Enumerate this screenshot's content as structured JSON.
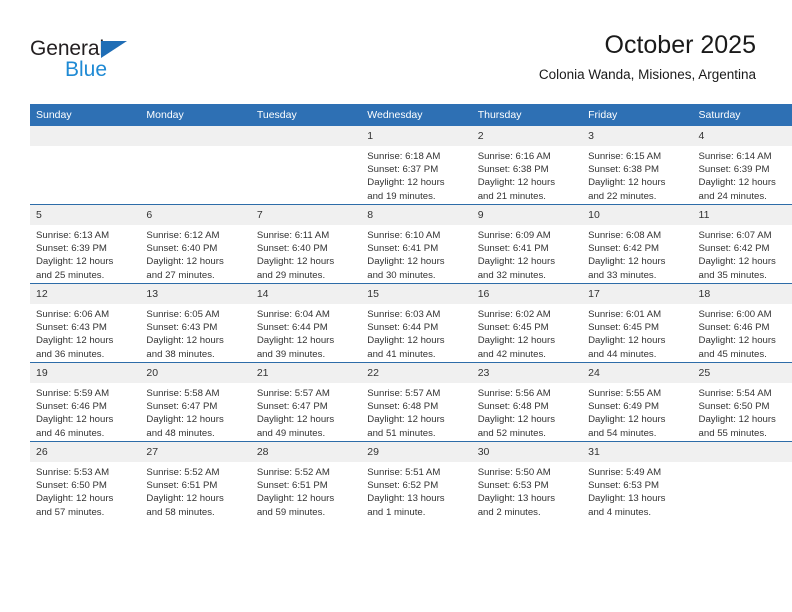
{
  "logo": {
    "word_top": "General",
    "word_bottom": "Blue",
    "triangle_color": "#1f6db5",
    "bottom_color": "#1f8ad4"
  },
  "header": {
    "title": "October 2025",
    "subtitle": "Colonia Wanda, Misiones, Argentina"
  },
  "theme": {
    "header_blue": "#2e70b4",
    "row_rule": "#2d6ca8",
    "daynum_band": "#f0f0f0",
    "text": "#333333"
  },
  "calendar": {
    "weekday_headers": [
      "Sunday",
      "Monday",
      "Tuesday",
      "Wednesday",
      "Thursday",
      "Friday",
      "Saturday"
    ],
    "weeks": [
      [
        {
          "day": "",
          "sunrise": "",
          "sunset": "",
          "daylight_1": "",
          "daylight_2": "",
          "empty": true
        },
        {
          "day": "",
          "sunrise": "",
          "sunset": "",
          "daylight_1": "",
          "daylight_2": "",
          "empty": true
        },
        {
          "day": "",
          "sunrise": "",
          "sunset": "",
          "daylight_1": "",
          "daylight_2": "",
          "empty": true
        },
        {
          "day": "1",
          "sunrise": "Sunrise: 6:18 AM",
          "sunset": "Sunset: 6:37 PM",
          "daylight_1": "Daylight: 12 hours",
          "daylight_2": "and 19 minutes."
        },
        {
          "day": "2",
          "sunrise": "Sunrise: 6:16 AM",
          "sunset": "Sunset: 6:38 PM",
          "daylight_1": "Daylight: 12 hours",
          "daylight_2": "and 21 minutes."
        },
        {
          "day": "3",
          "sunrise": "Sunrise: 6:15 AM",
          "sunset": "Sunset: 6:38 PM",
          "daylight_1": "Daylight: 12 hours",
          "daylight_2": "and 22 minutes."
        },
        {
          "day": "4",
          "sunrise": "Sunrise: 6:14 AM",
          "sunset": "Sunset: 6:39 PM",
          "daylight_1": "Daylight: 12 hours",
          "daylight_2": "and 24 minutes."
        }
      ],
      [
        {
          "day": "5",
          "sunrise": "Sunrise: 6:13 AM",
          "sunset": "Sunset: 6:39 PM",
          "daylight_1": "Daylight: 12 hours",
          "daylight_2": "and 25 minutes."
        },
        {
          "day": "6",
          "sunrise": "Sunrise: 6:12 AM",
          "sunset": "Sunset: 6:40 PM",
          "daylight_1": "Daylight: 12 hours",
          "daylight_2": "and 27 minutes."
        },
        {
          "day": "7",
          "sunrise": "Sunrise: 6:11 AM",
          "sunset": "Sunset: 6:40 PM",
          "daylight_1": "Daylight: 12 hours",
          "daylight_2": "and 29 minutes."
        },
        {
          "day": "8",
          "sunrise": "Sunrise: 6:10 AM",
          "sunset": "Sunset: 6:41 PM",
          "daylight_1": "Daylight: 12 hours",
          "daylight_2": "and 30 minutes."
        },
        {
          "day": "9",
          "sunrise": "Sunrise: 6:09 AM",
          "sunset": "Sunset: 6:41 PM",
          "daylight_1": "Daylight: 12 hours",
          "daylight_2": "and 32 minutes."
        },
        {
          "day": "10",
          "sunrise": "Sunrise: 6:08 AM",
          "sunset": "Sunset: 6:42 PM",
          "daylight_1": "Daylight: 12 hours",
          "daylight_2": "and 33 minutes."
        },
        {
          "day": "11",
          "sunrise": "Sunrise: 6:07 AM",
          "sunset": "Sunset: 6:42 PM",
          "daylight_1": "Daylight: 12 hours",
          "daylight_2": "and 35 minutes."
        }
      ],
      [
        {
          "day": "12",
          "sunrise": "Sunrise: 6:06 AM",
          "sunset": "Sunset: 6:43 PM",
          "daylight_1": "Daylight: 12 hours",
          "daylight_2": "and 36 minutes."
        },
        {
          "day": "13",
          "sunrise": "Sunrise: 6:05 AM",
          "sunset": "Sunset: 6:43 PM",
          "daylight_1": "Daylight: 12 hours",
          "daylight_2": "and 38 minutes."
        },
        {
          "day": "14",
          "sunrise": "Sunrise: 6:04 AM",
          "sunset": "Sunset: 6:44 PM",
          "daylight_1": "Daylight: 12 hours",
          "daylight_2": "and 39 minutes."
        },
        {
          "day": "15",
          "sunrise": "Sunrise: 6:03 AM",
          "sunset": "Sunset: 6:44 PM",
          "daylight_1": "Daylight: 12 hours",
          "daylight_2": "and 41 minutes."
        },
        {
          "day": "16",
          "sunrise": "Sunrise: 6:02 AM",
          "sunset": "Sunset: 6:45 PM",
          "daylight_1": "Daylight: 12 hours",
          "daylight_2": "and 42 minutes."
        },
        {
          "day": "17",
          "sunrise": "Sunrise: 6:01 AM",
          "sunset": "Sunset: 6:45 PM",
          "daylight_1": "Daylight: 12 hours",
          "daylight_2": "and 44 minutes."
        },
        {
          "day": "18",
          "sunrise": "Sunrise: 6:00 AM",
          "sunset": "Sunset: 6:46 PM",
          "daylight_1": "Daylight: 12 hours",
          "daylight_2": "and 45 minutes."
        }
      ],
      [
        {
          "day": "19",
          "sunrise": "Sunrise: 5:59 AM",
          "sunset": "Sunset: 6:46 PM",
          "daylight_1": "Daylight: 12 hours",
          "daylight_2": "and 46 minutes."
        },
        {
          "day": "20",
          "sunrise": "Sunrise: 5:58 AM",
          "sunset": "Sunset: 6:47 PM",
          "daylight_1": "Daylight: 12 hours",
          "daylight_2": "and 48 minutes."
        },
        {
          "day": "21",
          "sunrise": "Sunrise: 5:57 AM",
          "sunset": "Sunset: 6:47 PM",
          "daylight_1": "Daylight: 12 hours",
          "daylight_2": "and 49 minutes."
        },
        {
          "day": "22",
          "sunrise": "Sunrise: 5:57 AM",
          "sunset": "Sunset: 6:48 PM",
          "daylight_1": "Daylight: 12 hours",
          "daylight_2": "and 51 minutes."
        },
        {
          "day": "23",
          "sunrise": "Sunrise: 5:56 AM",
          "sunset": "Sunset: 6:48 PM",
          "daylight_1": "Daylight: 12 hours",
          "daylight_2": "and 52 minutes."
        },
        {
          "day": "24",
          "sunrise": "Sunrise: 5:55 AM",
          "sunset": "Sunset: 6:49 PM",
          "daylight_1": "Daylight: 12 hours",
          "daylight_2": "and 54 minutes."
        },
        {
          "day": "25",
          "sunrise": "Sunrise: 5:54 AM",
          "sunset": "Sunset: 6:50 PM",
          "daylight_1": "Daylight: 12 hours",
          "daylight_2": "and 55 minutes."
        }
      ],
      [
        {
          "day": "26",
          "sunrise": "Sunrise: 5:53 AM",
          "sunset": "Sunset: 6:50 PM",
          "daylight_1": "Daylight: 12 hours",
          "daylight_2": "and 57 minutes."
        },
        {
          "day": "27",
          "sunrise": "Sunrise: 5:52 AM",
          "sunset": "Sunset: 6:51 PM",
          "daylight_1": "Daylight: 12 hours",
          "daylight_2": "and 58 minutes."
        },
        {
          "day": "28",
          "sunrise": "Sunrise: 5:52 AM",
          "sunset": "Sunset: 6:51 PM",
          "daylight_1": "Daylight: 12 hours",
          "daylight_2": "and 59 minutes."
        },
        {
          "day": "29",
          "sunrise": "Sunrise: 5:51 AM",
          "sunset": "Sunset: 6:52 PM",
          "daylight_1": "Daylight: 13 hours",
          "daylight_2": "and 1 minute."
        },
        {
          "day": "30",
          "sunrise": "Sunrise: 5:50 AM",
          "sunset": "Sunset: 6:53 PM",
          "daylight_1": "Daylight: 13 hours",
          "daylight_2": "and 2 minutes."
        },
        {
          "day": "31",
          "sunrise": "Sunrise: 5:49 AM",
          "sunset": "Sunset: 6:53 PM",
          "daylight_1": "Daylight: 13 hours",
          "daylight_2": "and 4 minutes."
        },
        {
          "day": "",
          "sunrise": "",
          "sunset": "",
          "daylight_1": "",
          "daylight_2": "",
          "empty": true
        }
      ]
    ]
  }
}
